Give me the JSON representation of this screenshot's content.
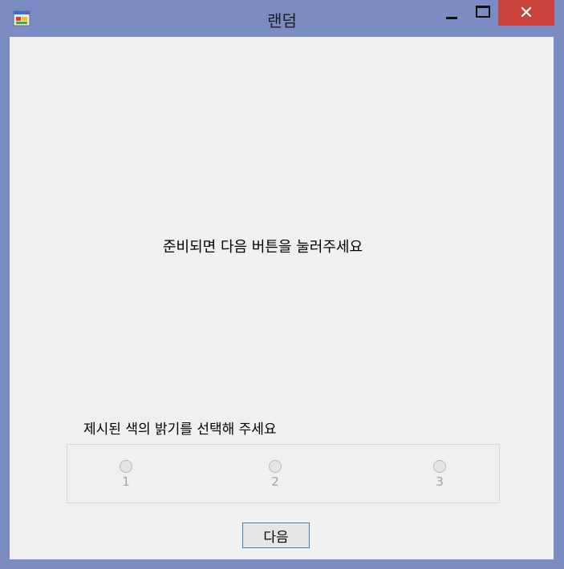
{
  "window": {
    "title": "랜덤",
    "close_glyph": "✕",
    "app_icon": "windows-forms-icon",
    "colors": {
      "frame": "#7b8bc4",
      "close": "#c9423c",
      "client": "#f0f0f0",
      "button_border": "#3c7fb1"
    }
  },
  "main": {
    "prompt": "준비되면 다음 버튼을 눌러주세요",
    "instruction": "제시된 색의 밝기를 선택해 주세요",
    "options": [
      {
        "label": "1",
        "checked": false,
        "enabled": false
      },
      {
        "label": "2",
        "checked": false,
        "enabled": false
      },
      {
        "label": "3",
        "checked": false,
        "enabled": false
      }
    ],
    "next_button_label": "다음"
  }
}
